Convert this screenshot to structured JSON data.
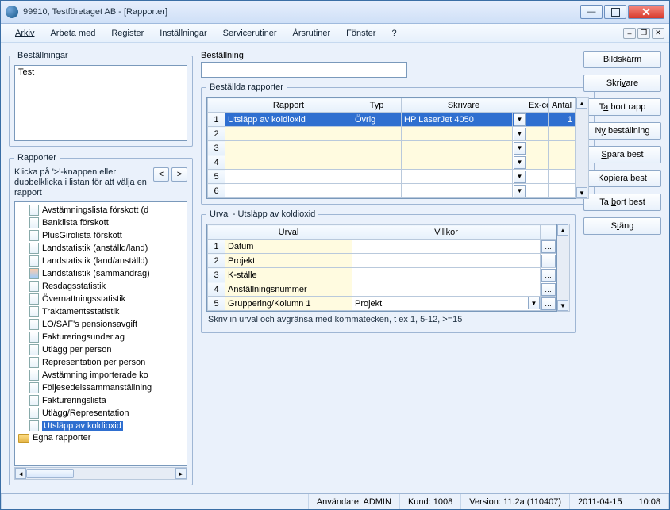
{
  "window": {
    "title": "99910, Testföretaget AB - [Rapporter]"
  },
  "menu": [
    "Arkiv",
    "Arbeta med",
    "Register",
    "Inställningar",
    "Servicerutiner",
    "Årsrutiner",
    "Fönster",
    "?"
  ],
  "left": {
    "bestallningar_legend": "Beställningar",
    "bestallningar_item": "Test",
    "rapporter_legend": "Rapporter",
    "hint": "Klicka på '>'-knappen eller dubbelklicka i listan för att välja en rapport",
    "items": [
      "Avstämningslista förskott (d",
      "Banklista förskott",
      "PlusGirolista förskott",
      "Landstatistik (anställd/land)",
      "Landstatistik (land/anställd)",
      "Landstatistik (sammandrag)",
      "Resdagsstatistik",
      "Övernattningsstatistik",
      "Traktamentsstatistik",
      "LO/SAF's pensionsavgift",
      "Faktureringsunderlag",
      "Utlägg per person",
      "Representation per person",
      "Avstämning importerade ko",
      "Följesedelssammanställning",
      "Faktureringslista",
      "Utlägg/Representation",
      "Utsläpp av koldioxid"
    ],
    "folder": "Egna rapporter"
  },
  "center": {
    "best_field_label": "Beställning",
    "best_field_value": "",
    "ordered_legend": "Beställda rapporter",
    "ordered_headers": {
      "rapport": "Rapport",
      "typ": "Typ",
      "skrivare": "Skrivare",
      "excel": "Ex-cel",
      "antal": "Antal"
    },
    "ordered_rows": [
      {
        "rapport": "Utsläpp av koldioxid",
        "typ": "Övrig",
        "skrivare": "HP LaserJet 4050",
        "antal": "1",
        "sel": true
      },
      {
        "rapport": "",
        "typ": "",
        "skrivare": "",
        "antal": ""
      },
      {
        "rapport": "",
        "typ": "",
        "skrivare": "",
        "antal": ""
      },
      {
        "rapport": "",
        "typ": "",
        "skrivare": "",
        "antal": ""
      },
      {
        "rapport": "",
        "typ": "",
        "skrivare": "",
        "antal": ""
      },
      {
        "rapport": "",
        "typ": "",
        "skrivare": "",
        "antal": ""
      }
    ],
    "urval_legend": "Urval - Utsläpp av koldioxid",
    "urval_headers": {
      "urval": "Urval",
      "villkor": "Villkor"
    },
    "urval_rows": [
      {
        "urval": "Datum",
        "villkor": ""
      },
      {
        "urval": "Projekt",
        "villkor": ""
      },
      {
        "urval": "K-ställe",
        "villkor": ""
      },
      {
        "urval": "Anställningsnummer",
        "villkor": ""
      },
      {
        "urval": "Gruppering/Kolumn 1",
        "villkor": "Projekt",
        "dropdown": true,
        "gray": true
      }
    ],
    "urval_hint": "Skriv in urval och avgränsa med kommatecken, t ex 1, 5-12, >=15"
  },
  "buttons": {
    "bildskarm": "Bildskärm",
    "skrivare": "Skrivare",
    "tabortrapp": "Ta bort rapp",
    "nybest": "Ny beställning",
    "sparabest": "Spara best",
    "kopierabest": "Kopiera best",
    "tabortbest": "Ta bort best",
    "stang": "Stäng"
  },
  "status": {
    "anvandare": "Användare: ADMIN",
    "kund": "Kund: 1008",
    "version": "Version: 11.2a  (110407)",
    "date": "2011-04-15",
    "time": "10:08"
  }
}
